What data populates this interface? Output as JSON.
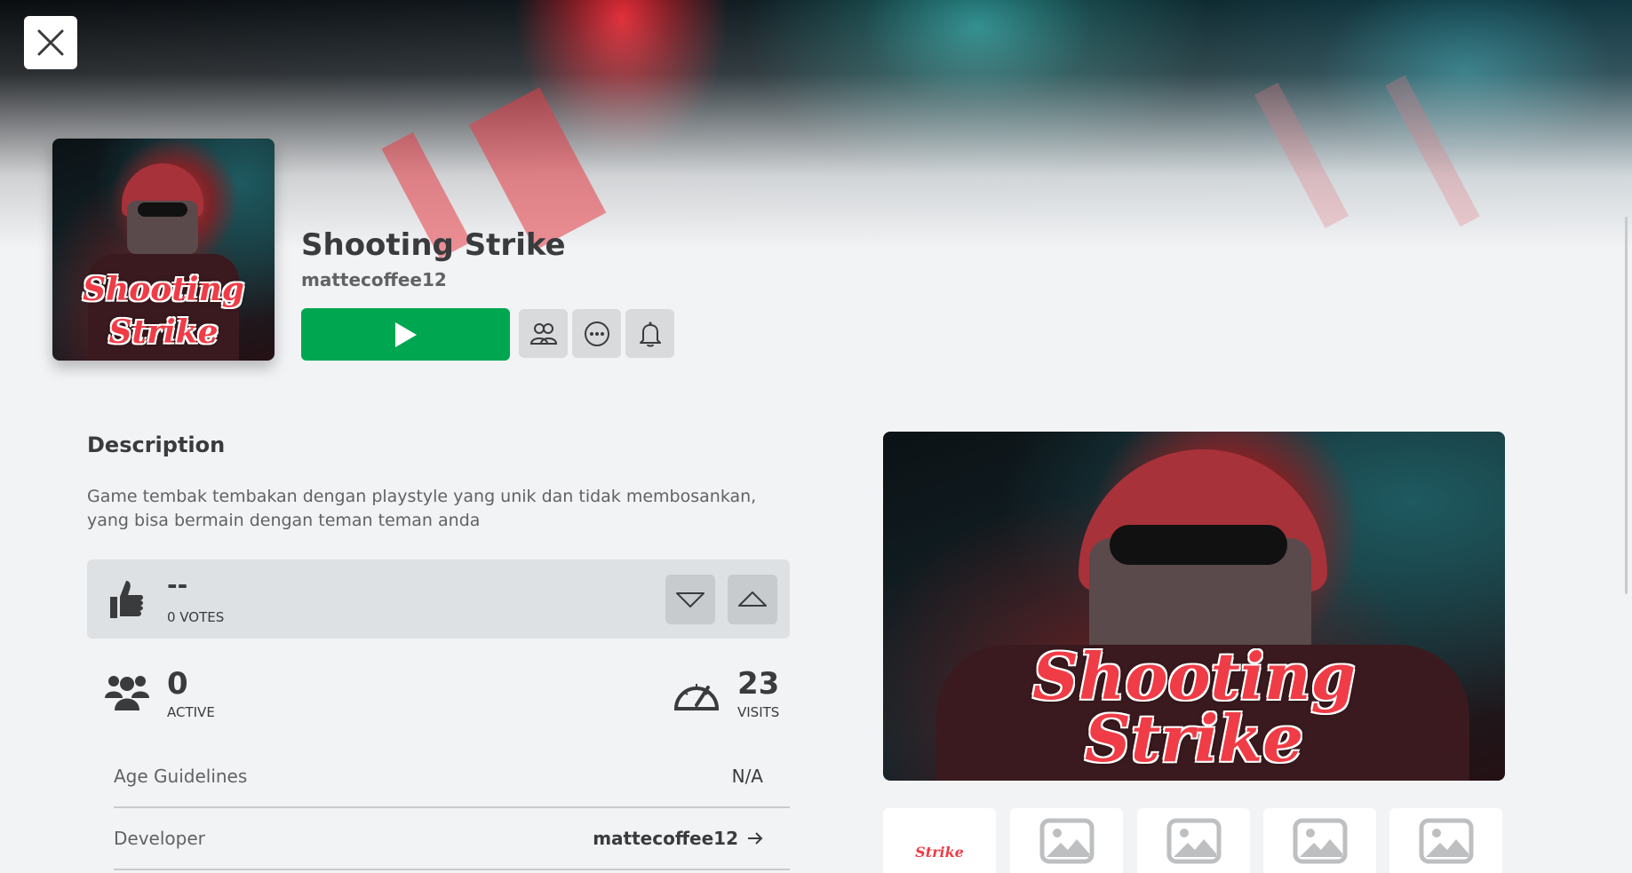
{
  "header": {
    "close_icon": "close-icon"
  },
  "game": {
    "title": "Shooting Strike",
    "creator": "mattecoffee12",
    "art_title_line1": "Shooting",
    "art_title_line2": "Strike"
  },
  "actions": {
    "play_icon": "play-icon",
    "party_icon": "people-icon",
    "more_icon": "more-icon",
    "notify_icon": "bell-icon"
  },
  "description": {
    "heading": "Description",
    "text": "Game tembak tembakan dengan playstyle yang unik dan tidak membosankan, yang bisa bermain dengan teman teman anda"
  },
  "votes": {
    "count": "--",
    "label": "0 VOTES"
  },
  "stats": {
    "active_value": "0",
    "active_label": "ACTIVE",
    "visits_value": "23",
    "visits_label": "VISITS"
  },
  "info": [
    {
      "label": "Age Guidelines",
      "value": "N/A"
    },
    {
      "label": "Developer",
      "value": "mattecoffee12"
    }
  ],
  "colors": {
    "play": "#00a650",
    "background": "#f2f3f5",
    "text": "#393b3d",
    "accent_red": "#f03c46"
  }
}
